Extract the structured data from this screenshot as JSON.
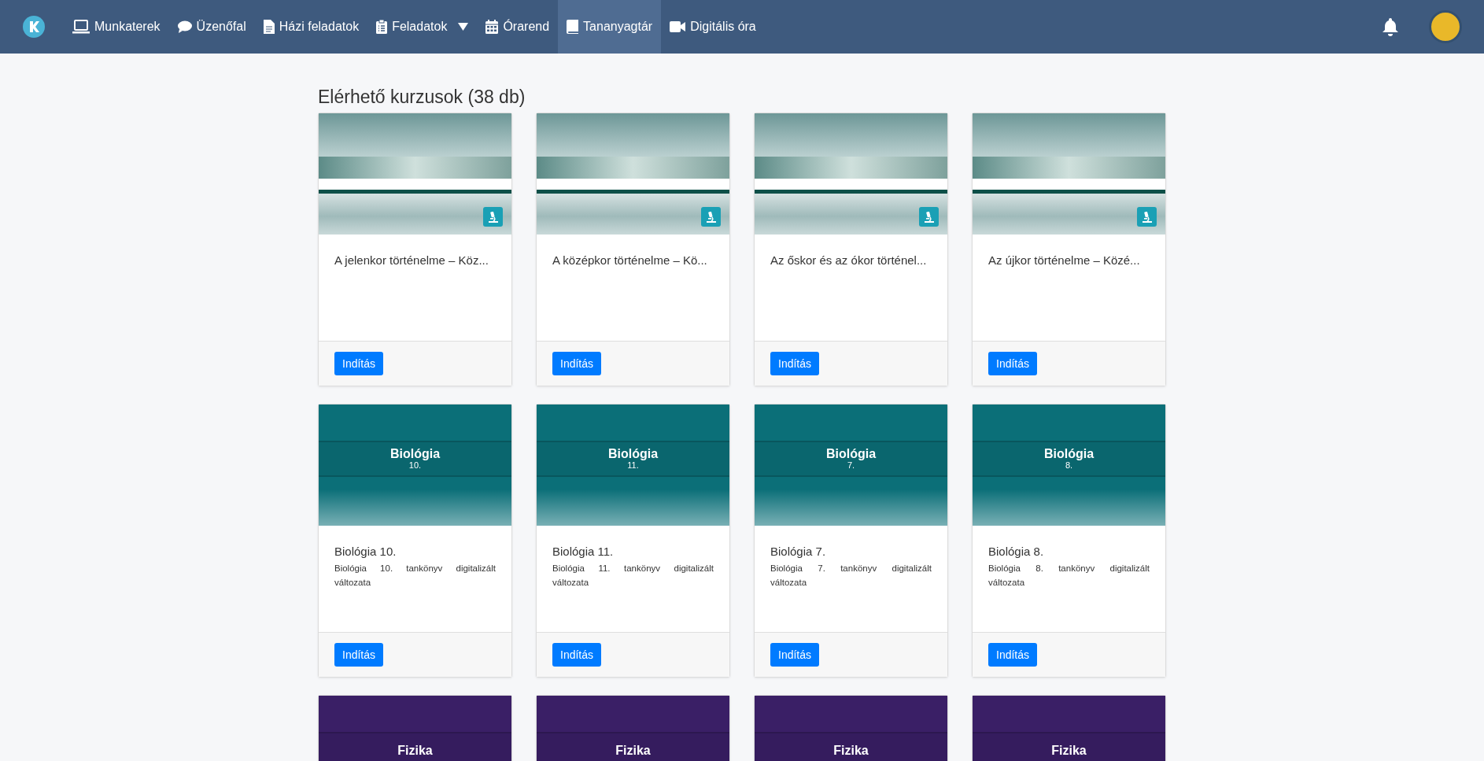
{
  "nav": {
    "items": [
      {
        "label": "Munkaterek",
        "selected": false,
        "dropdown": false
      },
      {
        "label": "Üzenőfal",
        "selected": false,
        "dropdown": false
      },
      {
        "label": "Házi feladatok",
        "selected": false,
        "dropdown": false
      },
      {
        "label": "Feladatok",
        "selected": false,
        "dropdown": true
      },
      {
        "label": "Órarend",
        "selected": false,
        "dropdown": false
      },
      {
        "label": "Tananyagtár",
        "selected": true,
        "dropdown": false
      },
      {
        "label": "Digitális óra",
        "selected": false,
        "dropdown": false
      }
    ]
  },
  "heading": "Elérhető kurzusok (38 db)",
  "courses": [
    {
      "kind": "banner",
      "title": "A jelenkor történelme – Köz...",
      "button": "Indítás"
    },
    {
      "kind": "banner",
      "title": "A középkor történelme – Kö...",
      "button": "Indítás"
    },
    {
      "kind": "banner",
      "title": "Az őskor és az ókor történel...",
      "button": "Indítás"
    },
    {
      "kind": "banner",
      "title": "Az újkor történelme – Közé...",
      "button": "Indítás"
    },
    {
      "kind": "cover",
      "color": "#0b6f78",
      "cover_title": "Biológia",
      "cover_subtitle": "10.",
      "title": "Biológia 10.",
      "description": "Biológia 10. tankönyv digitalizált változata",
      "button": "Indítás"
    },
    {
      "kind": "cover",
      "color": "#0b6f78",
      "cover_title": "Biológia",
      "cover_subtitle": "11.",
      "title": "Biológia 11.",
      "description": "Biológia 11. tankönyv digitalizált változata",
      "button": "Indítás"
    },
    {
      "kind": "cover",
      "color": "#0b6f78",
      "cover_title": "Biológia",
      "cover_subtitle": "7.",
      "title": "Biológia 7.",
      "description": "Biológia 7. tankönyv digitalizált változata",
      "button": "Indítás"
    },
    {
      "kind": "cover",
      "color": "#0b6f78",
      "cover_title": "Biológia",
      "cover_subtitle": "8.",
      "title": "Biológia 8.",
      "description": "Biológia 8. tankönyv digitalizált változata",
      "button": "Indítás"
    },
    {
      "kind": "cover",
      "color": "#3a1f66",
      "cover_title": "Fizika"
    },
    {
      "kind": "cover",
      "color": "#3a1f66",
      "cover_title": "Fizika"
    },
    {
      "kind": "cover",
      "color": "#3a1f66",
      "cover_title": "Fizika"
    },
    {
      "kind": "cover",
      "color": "#3a1f66",
      "cover_title": "Fizika"
    }
  ]
}
